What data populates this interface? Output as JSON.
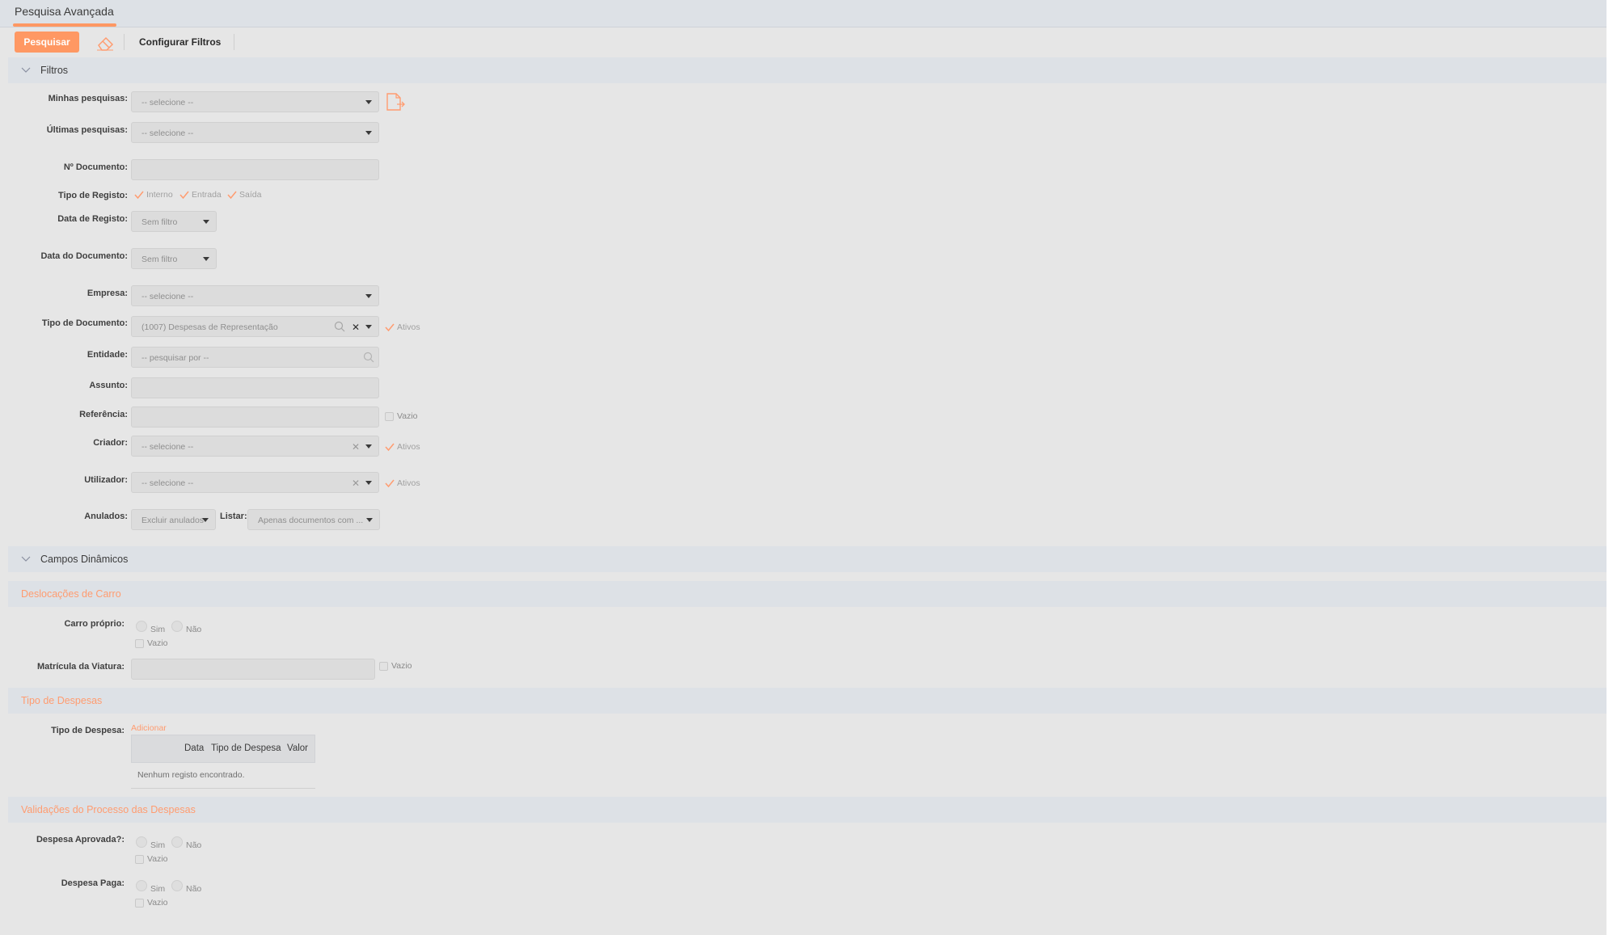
{
  "tab": {
    "title": "Pesquisa Avançada"
  },
  "toolbar": {
    "search_label": "Pesquisar",
    "configure_label": "Configurar Filtros"
  },
  "colors": {
    "accent": "#ff9863",
    "section_bg": "#dde1e6",
    "page_bg": "#e6e6e6"
  },
  "filters": {
    "section_title": "Filtros",
    "minhas_pesquisas": {
      "label": "Minhas pesquisas:",
      "value": "-- selecione --"
    },
    "ultimas_pesquisas": {
      "label": "Últimas pesquisas:",
      "value": "-- selecione --"
    },
    "n_documento": {
      "label": "Nº Documento:",
      "value": ""
    },
    "tipo_registo": {
      "label": "Tipo de Registo:",
      "options": [
        "Interno",
        "Entrada",
        "Saída"
      ]
    },
    "data_registo": {
      "label": "Data de Registo:",
      "value": "Sem filtro"
    },
    "data_documento": {
      "label": "Data do Documento:",
      "value": "Sem filtro"
    },
    "empresa": {
      "label": "Empresa:",
      "value": "-- selecione --"
    },
    "tipo_documento": {
      "label": "Tipo de Documento:",
      "value": "(1007) Despesas de Representação",
      "check": "Ativos"
    },
    "entidade": {
      "label": "Entidade:",
      "placeholder": "-- pesquisar por --"
    },
    "assunto": {
      "label": "Assunto:",
      "value": ""
    },
    "referencia": {
      "label": "Referência:",
      "value": "",
      "check": "Vazio"
    },
    "criador": {
      "label": "Criador:",
      "value": "-- selecione --",
      "check": "Ativos"
    },
    "utilizador": {
      "label": "Utilizador:",
      "value": "-- selecione --",
      "check": "Ativos"
    },
    "anulados": {
      "label": "Anulados:",
      "value": "Excluir anulados"
    },
    "listar": {
      "label": "Listar:",
      "value": "Apenas documentos com ..."
    }
  },
  "dynamic": {
    "section_title": "Campos Dinâmicos"
  },
  "deslocacoes": {
    "section_title": "Deslocações de Carro",
    "carro_proprio": {
      "label": "Carro próprio:",
      "yes": "Sim",
      "no": "Não",
      "empty": "Vazio"
    },
    "matricula": {
      "label": "Matrícula da Viatura:",
      "value": "",
      "empty": "Vazio"
    }
  },
  "tipo_despesas": {
    "section_title": "Tipo de Despesas",
    "label": "Tipo de Despesa:",
    "add_label": "Adicionar",
    "columns": [
      "Data",
      "Tipo de Despesa",
      "Valor"
    ],
    "empty_message": "Nenhum registo encontrado."
  },
  "validacoes": {
    "section_title": "Validações do Processo das Despesas",
    "aprovada": {
      "label": "Despesa Aprovada?:",
      "yes": "Sim",
      "no": "Não",
      "empty": "Vazio"
    },
    "paga": {
      "label": "Despesa Paga:",
      "yes": "Sim",
      "no": "Não",
      "empty": "Vazio"
    }
  }
}
